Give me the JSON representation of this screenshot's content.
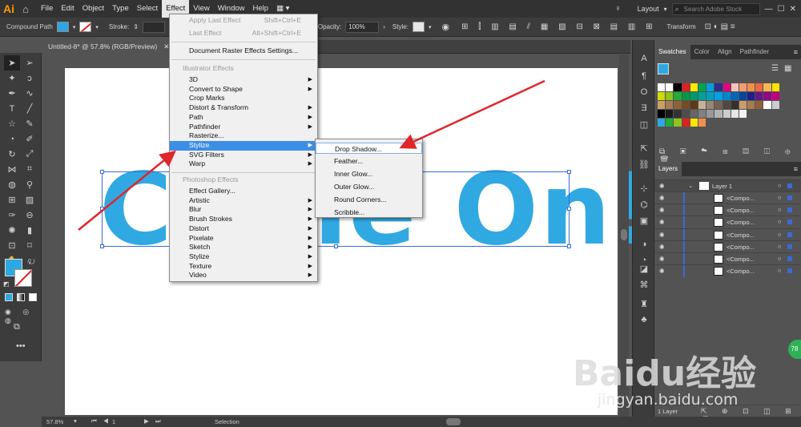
{
  "app": {
    "logo": "Ai",
    "home_icon": "home-icon"
  },
  "menubar": {
    "items": [
      "File",
      "Edit",
      "Object",
      "Type",
      "Select",
      "Effect",
      "View",
      "Window",
      "Help"
    ],
    "active": "Effect",
    "layout_label": "Layout",
    "search_placeholder": "Search Adobe Stock"
  },
  "control_bar": {
    "selection_label": "Compound Path",
    "stroke_label": "Stroke:",
    "opacity_label": "Opacity:",
    "opacity_value": "100%",
    "style_label": "Style:",
    "transform_label": "Transform",
    "fill_color": "#2ea8e0"
  },
  "document": {
    "tab_title": "Untitled-8* @ 57.8% (RGB/Preview)",
    "artboard_text": "Come On!"
  },
  "effect_menu": {
    "apply_last": "Apply Last Effect",
    "apply_last_shortcut": "Shift+Ctrl+E",
    "last_effect": "Last Effect",
    "last_effect_shortcut": "Alt+Shift+Ctrl+E",
    "doc_raster": "Document Raster Effects Settings...",
    "illustrator_header": "Illustrator Effects",
    "illustrator_items": [
      "3D",
      "Convert to Shape",
      "Crop Marks",
      "Distort & Transform",
      "Path",
      "Pathfinder",
      "Rasterize...",
      "Stylize",
      "SVG Filters",
      "Warp"
    ],
    "photoshop_header": "Photoshop Effects",
    "photoshop_items": [
      "Effect Gallery...",
      "Artistic",
      "Blur",
      "Brush Strokes",
      "Distort",
      "Pixelate",
      "Sketch",
      "Stylize",
      "Texture",
      "Video"
    ],
    "highlighted": "Stylize"
  },
  "stylize_submenu": {
    "items": [
      "Drop Shadow...",
      "Feather...",
      "Inner Glow...",
      "Outer Glow...",
      "Round Corners...",
      "Scribble..."
    ],
    "highlighted": "Drop Shadow..."
  },
  "swatches_panel": {
    "tabs": [
      "Swatches",
      "Color",
      "Align",
      "Pathfinder"
    ]
  },
  "layers_panel": {
    "title": "Layers",
    "layer_name": "Layer 1",
    "sublayers": [
      "<Compo...",
      "<Compo...",
      "<Compo...",
      "<Compo...",
      "<Compo...",
      "<Compo...",
      "<Compo..."
    ],
    "footer": "1 Layer"
  },
  "status_bar": {
    "zoom": "57.8%",
    "page": "1",
    "tool": "Selection"
  },
  "watermark": {
    "text": "Baidu经验",
    "url": "jingyan.baidu.com",
    "badge": "78"
  },
  "colors": {
    "accent": "#3d8ee5",
    "artwork_blue": "#30a9e3",
    "arrow_red": "#e0262b",
    "selection_blue": "#3a6ad8"
  }
}
